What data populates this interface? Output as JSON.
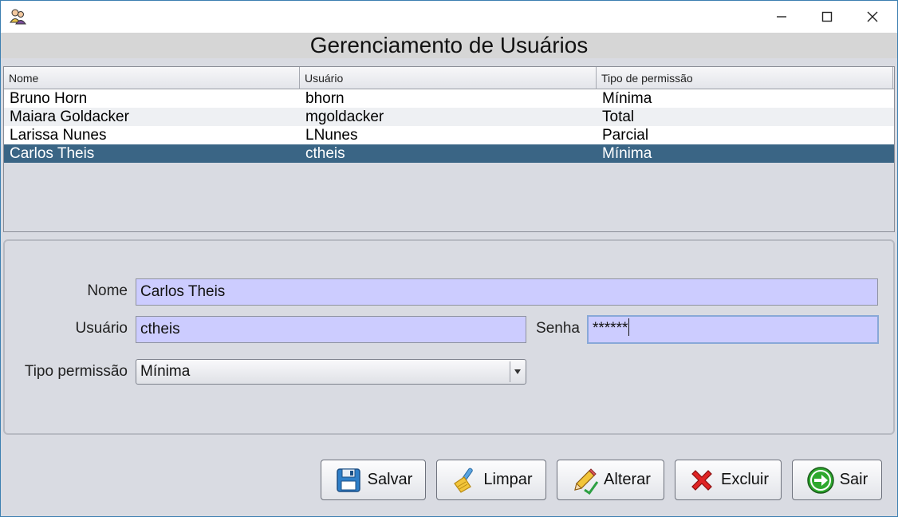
{
  "window": {
    "icons": {
      "app": "users-app-icon",
      "minimize": "minimize-icon",
      "maximize": "maximize-icon",
      "close": "close-icon"
    }
  },
  "header": {
    "title": "Gerenciamento de Usuários"
  },
  "table": {
    "columns": [
      "Nome",
      "Usuário",
      "Tipo de permissão"
    ],
    "rows": [
      {
        "nome": "Bruno Horn",
        "usuario": "bhorn",
        "tipo": "Mínima"
      },
      {
        "nome": "Maiara Goldacker",
        "usuario": "mgoldacker",
        "tipo": "Total"
      },
      {
        "nome": "Larissa Nunes",
        "usuario": "LNunes",
        "tipo": "Parcial"
      },
      {
        "nome": "Carlos Theis",
        "usuario": "ctheis",
        "tipo": "Mínima"
      }
    ],
    "selected_row": 3,
    "colors": {
      "selected_bg": "#3a6585",
      "selected_text": "#ffffff"
    }
  },
  "form": {
    "nome": {
      "label": "Nome",
      "value": "Carlos Theis"
    },
    "usuario": {
      "label": "Usuário",
      "value": "ctheis"
    },
    "senha": {
      "label": "Senha",
      "value": "******"
    },
    "tipo": {
      "label": "Tipo permissão",
      "value": "Mínima"
    },
    "field_bg": "#ccccff"
  },
  "buttons": {
    "salvar": {
      "label": "Salvar",
      "icon": "floppy-disk-icon"
    },
    "limpar": {
      "label": "Limpar",
      "icon": "broom-icon"
    },
    "alterar": {
      "label": "Alterar",
      "icon": "pencil-icon"
    },
    "excluir": {
      "label": "Excluir",
      "icon": "red-x-icon"
    },
    "sair": {
      "label": "Sair",
      "icon": "green-arrow-icon"
    }
  }
}
